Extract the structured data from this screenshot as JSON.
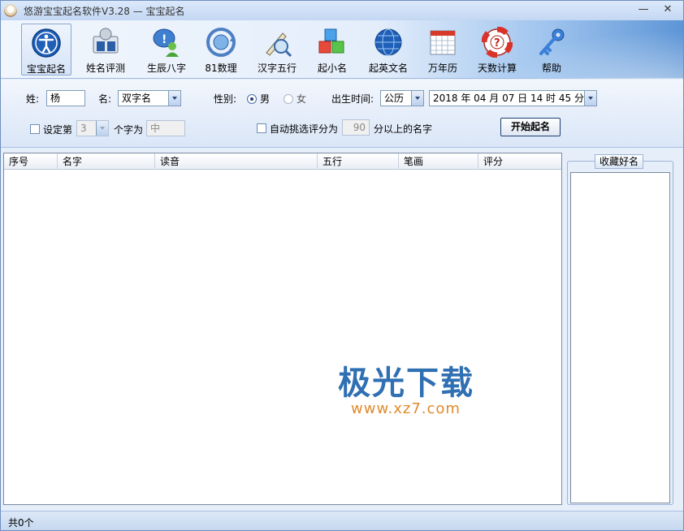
{
  "window": {
    "title": "悠游宝宝起名软件V3.28 — 宝宝起名",
    "controls": {
      "minimize": "—",
      "close": "✕"
    }
  },
  "toolbar": {
    "items": [
      {
        "label": "宝宝起名",
        "icon": "accessibility-icon",
        "active": true
      },
      {
        "label": "姓名评测",
        "icon": "people-board-icon"
      },
      {
        "label": "生辰八字",
        "icon": "chat-person-icon"
      },
      {
        "label": "81数理",
        "icon": "refresh-globe-icon"
      },
      {
        "label": "汉字五行",
        "icon": "pen-magnifier-icon"
      },
      {
        "label": "起小名",
        "icon": "cubes-icon"
      },
      {
        "label": "起英文名",
        "icon": "globe-icon"
      },
      {
        "label": "万年历",
        "icon": "calendar-icon"
      },
      {
        "label": "天数计算",
        "icon": "lifebuoy-help-icon"
      },
      {
        "label": "帮助",
        "icon": "key-icon"
      }
    ]
  },
  "params": {
    "surname_label": "姓:",
    "surname_value": "杨",
    "given_label": "名:",
    "given_value": "双字名",
    "gender_label": "性别:",
    "gender_male": "男",
    "gender_female": "女",
    "birth_label": "出生时间:",
    "calendar_value": "公历",
    "birth_value": "2018 年 04 月 07 日  14 时 45 分",
    "set_char_label": "设定第",
    "set_char_index": "3",
    "set_char_suffix": "个字为",
    "set_char_value": "中",
    "auto_select_label": "自动挑选评分为",
    "auto_select_score": "90",
    "auto_select_suffix": "分以上的名字",
    "start_button": "开始起名"
  },
  "results": {
    "columns": [
      "序号",
      "名字",
      "读音",
      "五行",
      "笔画",
      "评分"
    ],
    "rows": []
  },
  "watermark": {
    "title": "极光下载",
    "url": "www.xz7.com"
  },
  "favorites": {
    "title": "收藏好名"
  },
  "status": {
    "count_text": "共0个"
  },
  "colors": {
    "accent": "#2f6fb3",
    "toolbar_gradient_end": "#5d95d6",
    "watermark_url": "#e08a2c"
  }
}
